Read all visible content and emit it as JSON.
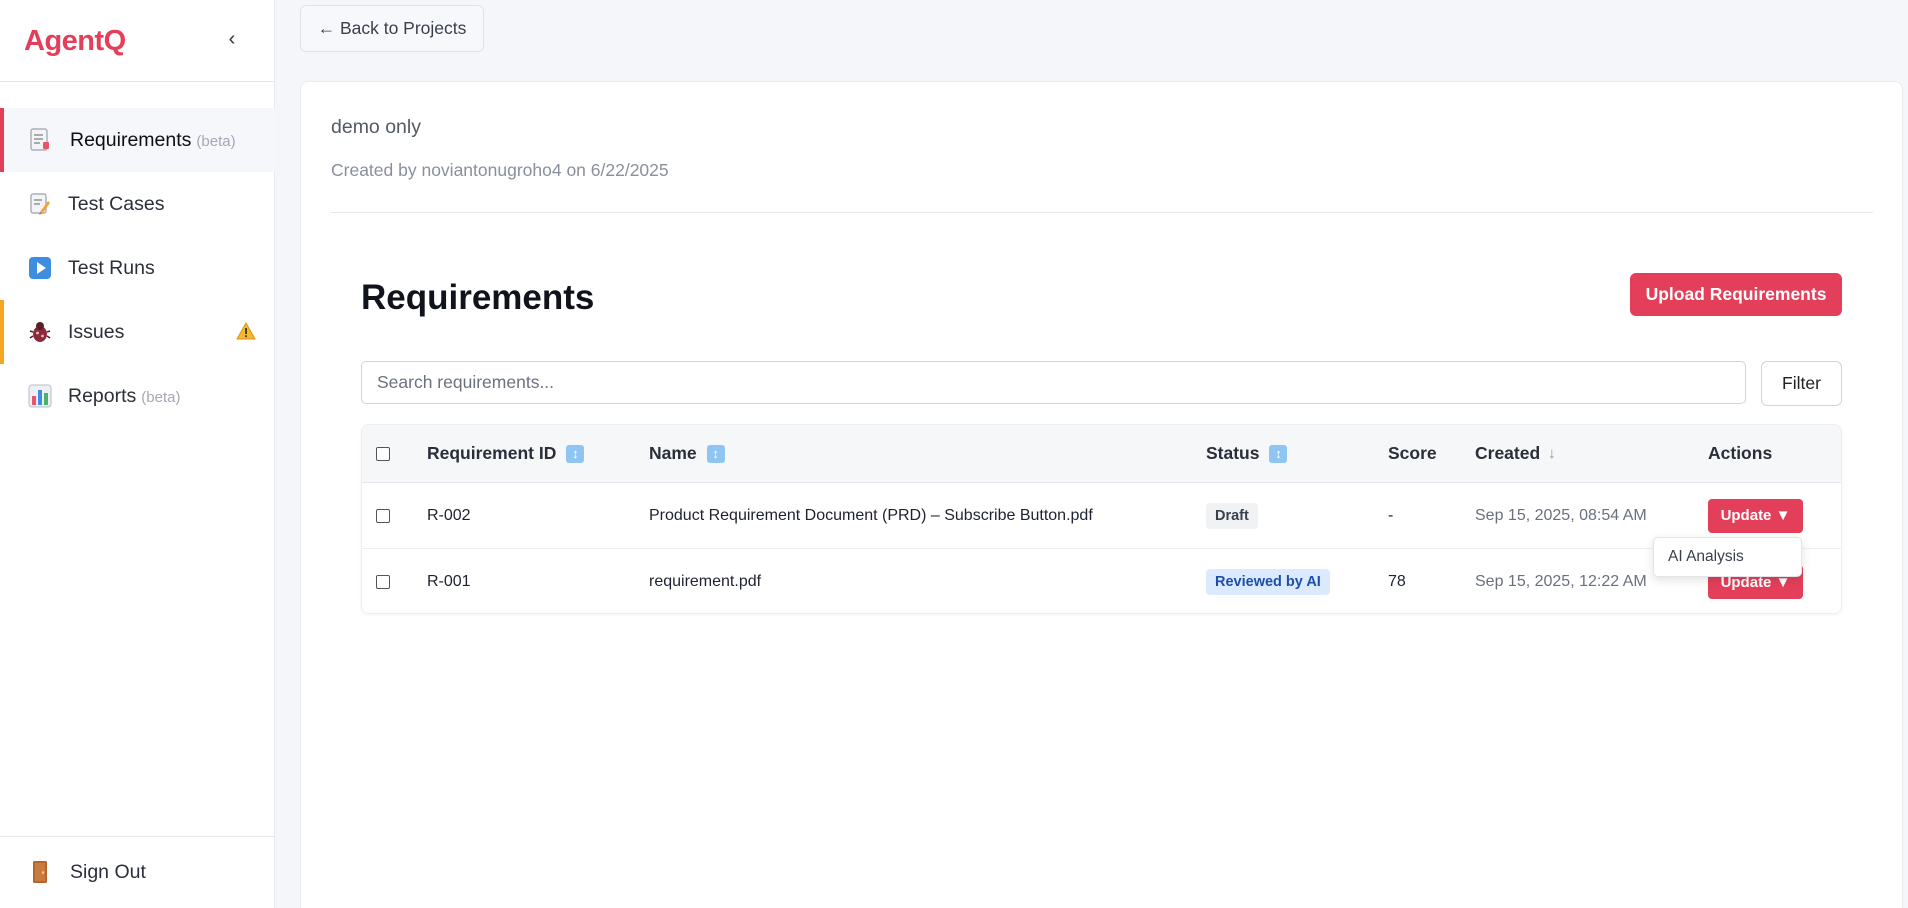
{
  "app": {
    "brand": "AgentQ",
    "collapse_glyph": "‹",
    "brand_color": "#e43f5a"
  },
  "sidebar": {
    "items": [
      {
        "label": "Requirements",
        "badge": "(beta)",
        "icon": "requirements-doc-icon",
        "active": true
      },
      {
        "label": "Test Cases",
        "badge": "",
        "icon": "test-cases-pencil-icon"
      },
      {
        "label": "Test Runs",
        "badge": "",
        "icon": "play-icon"
      },
      {
        "label": "Issues",
        "badge": "",
        "icon": "bug-icon",
        "warning": true
      },
      {
        "label": "Reports",
        "badge": "(beta)",
        "icon": "bar-chart-icon"
      }
    ],
    "sign_out": {
      "label": "Sign Out",
      "icon": "door-icon"
    }
  },
  "main": {
    "back_label": "← Back to Projects",
    "project": {
      "name": "demo only",
      "meta": "Created by noviantonugroho4 on 6/22/2025"
    },
    "section_title": "Requirements",
    "upload_label": "Upload Requirements",
    "search": {
      "placeholder": "Search requirements...",
      "value": ""
    },
    "filter_label": "Filter",
    "table": {
      "columns": {
        "id": "Requirement ID",
        "name": "Name",
        "status": "Status",
        "score": "Score",
        "created": "Created",
        "created_sort": "↓",
        "actions": "Actions"
      },
      "rows": [
        {
          "id": "R-002",
          "name": "Product Requirement Document (PRD) – Subscribe Button.pdf",
          "status": "Draft",
          "score": "-",
          "created": "Sep 15, 2025, 08:54 AM",
          "action": "Update ▼"
        },
        {
          "id": "R-001",
          "name": "requirement.pdf",
          "status": "Reviewed by AI",
          "score": "78",
          "created": "Sep 15, 2025, 12:22 AM",
          "action": "Update ▼"
        }
      ]
    },
    "dropdown": {
      "items": [
        "AI Analysis"
      ]
    }
  }
}
